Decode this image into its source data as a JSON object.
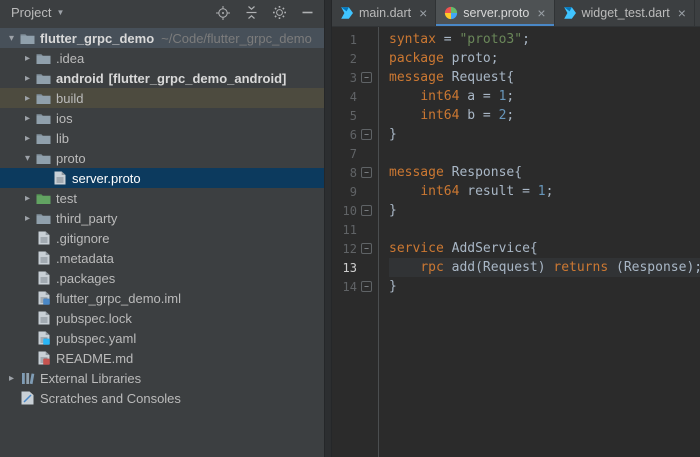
{
  "colors": {
    "panel_bg": "#3c3f41",
    "editor_bg": "#2b2b2b",
    "selected_row": "#0c3a5e",
    "excluded_row": "#4d4b3f",
    "root_row": "#475059",
    "keyword": "#cc7832",
    "string": "#6a8759",
    "number": "#6897bb",
    "code_text": "#a9b7c6",
    "line_number": "#606366",
    "active_tab_underline": "#4A88C7"
  },
  "project_panel": {
    "title": "Project",
    "toolbar": [
      {
        "name": "locate-file-icon"
      },
      {
        "name": "collapse-all-icon"
      },
      {
        "name": "settings-icon"
      },
      {
        "name": "hide-panel-icon"
      }
    ],
    "tree": [
      {
        "label": "flutter_grpc_demo",
        "hint": "~/Code/flutter_grpc_demo",
        "icon": "folder",
        "indent": 0,
        "arrow": "expanded",
        "bold": true,
        "highlight": "ghost"
      },
      {
        "label": ".idea",
        "icon": "folder",
        "indent": 1,
        "arrow": "collapsed"
      },
      {
        "label": "android",
        "hint": "[flutter_grpc_demo_android]",
        "hint_bold": true,
        "icon": "folder",
        "indent": 1,
        "arrow": "collapsed",
        "bold": true
      },
      {
        "label": "build",
        "icon": "folder",
        "indent": 1,
        "arrow": "collapsed",
        "highlight": "excluded"
      },
      {
        "label": "ios",
        "icon": "folder",
        "indent": 1,
        "arrow": "collapsed"
      },
      {
        "label": "lib",
        "icon": "folder",
        "indent": 1,
        "arrow": "collapsed"
      },
      {
        "label": "proto",
        "icon": "folder",
        "indent": 1,
        "arrow": "expanded"
      },
      {
        "label": "server.proto",
        "icon": "file",
        "indent": 2,
        "highlight": "selected"
      },
      {
        "label": "test",
        "icon": "folder-test",
        "indent": 1,
        "arrow": "collapsed"
      },
      {
        "label": "third_party",
        "icon": "folder",
        "indent": 1,
        "arrow": "collapsed"
      },
      {
        "label": ".gitignore",
        "icon": "file",
        "indent": 1
      },
      {
        "label": ".metadata",
        "icon": "file",
        "indent": 1
      },
      {
        "label": ".packages",
        "icon": "file",
        "indent": 1
      },
      {
        "label": "flutter_grpc_demo.iml",
        "icon": "file-iml",
        "indent": 1
      },
      {
        "label": "pubspec.lock",
        "icon": "file",
        "indent": 1
      },
      {
        "label": "pubspec.yaml",
        "icon": "file-yaml",
        "indent": 1
      },
      {
        "label": "README.md",
        "icon": "file-md",
        "indent": 1
      },
      {
        "label": "External Libraries",
        "icon": "library",
        "indent": 0,
        "arrow": "collapsed"
      },
      {
        "label": "Scratches and Consoles",
        "icon": "scratch",
        "indent": 0
      }
    ]
  },
  "editor": {
    "tabs": [
      {
        "label": "main.dart",
        "icon": "dart-icon",
        "active": false
      },
      {
        "label": "server.proto",
        "icon": "proto-icon",
        "active": true
      },
      {
        "label": "widget_test.dart",
        "icon": "dart-icon",
        "active": false
      }
    ],
    "active_line": 13,
    "lines": [
      {
        "n": 1,
        "fold": null,
        "tokens": [
          {
            "t": "syntax",
            "c": "kw"
          },
          {
            "t": " = ",
            "c": "pl"
          },
          {
            "t": "\"proto3\"",
            "c": "str"
          },
          {
            "t": ";",
            "c": "pl"
          }
        ]
      },
      {
        "n": 2,
        "fold": null,
        "tokens": [
          {
            "t": "package",
            "c": "kw"
          },
          {
            "t": " proto;",
            "c": "pl"
          }
        ]
      },
      {
        "n": 3,
        "fold": "start",
        "tokens": [
          {
            "t": "message",
            "c": "kw"
          },
          {
            "t": " Request{",
            "c": "pl"
          }
        ]
      },
      {
        "n": 4,
        "fold": null,
        "tokens": [
          {
            "t": "    ",
            "c": "pl"
          },
          {
            "t": "int64",
            "c": "kw"
          },
          {
            "t": " a = ",
            "c": "pl"
          },
          {
            "t": "1",
            "c": "num"
          },
          {
            "t": ";",
            "c": "pl"
          }
        ]
      },
      {
        "n": 5,
        "fold": null,
        "tokens": [
          {
            "t": "    ",
            "c": "pl"
          },
          {
            "t": "int64",
            "c": "kw"
          },
          {
            "t": " b = ",
            "c": "pl"
          },
          {
            "t": "2",
            "c": "num"
          },
          {
            "t": ";",
            "c": "pl"
          }
        ]
      },
      {
        "n": 6,
        "fold": "end",
        "tokens": [
          {
            "t": "}",
            "c": "pl"
          }
        ]
      },
      {
        "n": 7,
        "fold": null,
        "tokens": []
      },
      {
        "n": 8,
        "fold": "start",
        "tokens": [
          {
            "t": "message",
            "c": "kw"
          },
          {
            "t": " Response{",
            "c": "pl"
          }
        ]
      },
      {
        "n": 9,
        "fold": null,
        "tokens": [
          {
            "t": "    ",
            "c": "pl"
          },
          {
            "t": "int64",
            "c": "kw"
          },
          {
            "t": " result = ",
            "c": "pl"
          },
          {
            "t": "1",
            "c": "num"
          },
          {
            "t": ";",
            "c": "pl"
          }
        ]
      },
      {
        "n": 10,
        "fold": "end",
        "tokens": [
          {
            "t": "}",
            "c": "pl"
          }
        ]
      },
      {
        "n": 11,
        "fold": null,
        "tokens": []
      },
      {
        "n": 12,
        "fold": "start",
        "tokens": [
          {
            "t": "service",
            "c": "kw"
          },
          {
            "t": " AddService{",
            "c": "pl"
          }
        ]
      },
      {
        "n": 13,
        "fold": null,
        "tokens": [
          {
            "t": "    ",
            "c": "pl"
          },
          {
            "t": "rpc",
            "c": "kw"
          },
          {
            "t": " add(Request) ",
            "c": "pl"
          },
          {
            "t": "returns",
            "c": "kw"
          },
          {
            "t": " (Response);",
            "c": "pl"
          }
        ]
      },
      {
        "n": 14,
        "fold": "end",
        "tokens": [
          {
            "t": "}",
            "c": "pl"
          }
        ]
      }
    ]
  }
}
